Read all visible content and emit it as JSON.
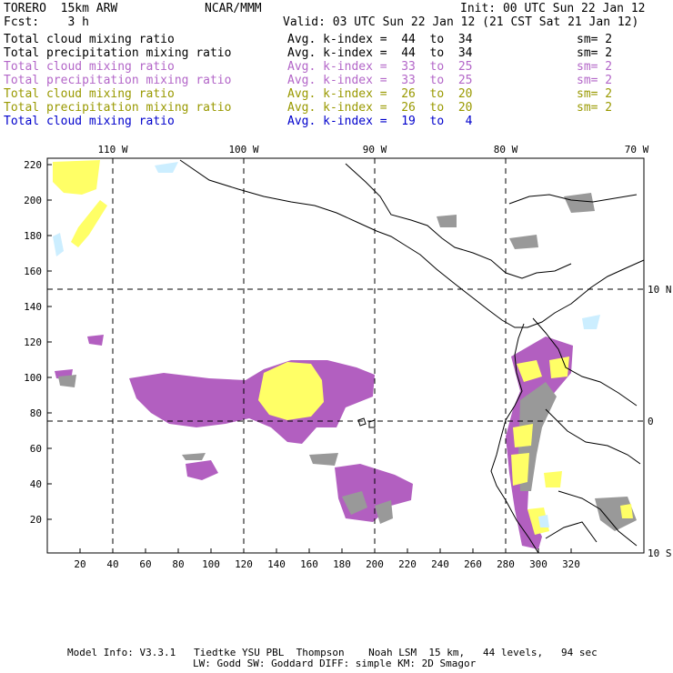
{
  "header": {
    "model": "TORERO  15km ARW",
    "center": "NCAR/MMM",
    "init": "Init: 00 UTC Sun 22 Jan 12",
    "fcst": "Fcst:    3 h",
    "valid": "Valid: 03 UTC Sun 22 Jan 12 (21 CST Sat 21 Jan 12)"
  },
  "legend": [
    {
      "field": "Total cloud mixing ratio",
      "index": "Avg. k-index =  44  to  34",
      "sm": "sm= 2",
      "color": "#000000"
    },
    {
      "field": "Total precipitation mixing ratio",
      "index": "Avg. k-index =  44  to  34",
      "sm": "sm= 2",
      "color": "#000000"
    },
    {
      "field": "Total cloud mixing ratio",
      "index": "Avg. k-index =  33  to  25",
      "sm": "sm= 2",
      "color": "#b366c8"
    },
    {
      "field": "Total precipitation mixing ratio",
      "index": "Avg. k-index =  33  to  25",
      "sm": "sm= 2",
      "color": "#b366c8"
    },
    {
      "field": "Total cloud mixing ratio",
      "index": "Avg. k-index =  26  to  20",
      "sm": "sm= 2",
      "color": "#999900"
    },
    {
      "field": "Total precipitation mixing ratio",
      "index": "Avg. k-index =  26  to  20",
      "sm": "sm= 2",
      "color": "#999900"
    },
    {
      "field": "Total cloud mixing ratio",
      "index": "Avg. k-index =  19  to   4",
      "sm": "",
      "color": "#0000cc"
    }
  ],
  "map": {
    "lon_labels": [
      "110 W",
      "100 W",
      "90 W",
      "80 W",
      "70 W"
    ],
    "lat_labels": [
      "10 N",
      "0",
      "10 S"
    ],
    "y_ticks": [
      "220",
      "200",
      "180",
      "160",
      "140",
      "120",
      "100",
      "80",
      "60",
      "40",
      "20"
    ],
    "x_ticks": [
      "20",
      "40",
      "60",
      "80",
      "100",
      "120",
      "140",
      "160",
      "180",
      "200",
      "220",
      "240",
      "260",
      "280",
      "300",
      "320"
    ],
    "colors": {
      "purple": "#b25fc0",
      "yellow": "#ffff66",
      "gray": "#999999",
      "lightblue": "#cceeff",
      "coast": "#000000"
    }
  },
  "footer": {
    "line1": "Model Info: V3.3.1   Tiedtke YSU PBL  Thompson    Noah LSM  15 km,   44 levels,   94 sec",
    "line2": "LW: Godd SW: Goddard DIFF: simple KM: 2D Smagor"
  }
}
